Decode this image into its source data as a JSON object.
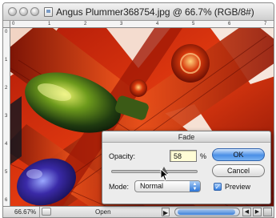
{
  "window": {
    "title": "Angus Plummer368754.jpg @ 66.7% (RGB/8#)",
    "zoom": "66.67%",
    "status_label": "Open",
    "status_arrow": "▶"
  },
  "rulers": {
    "top_numbers": [
      "0",
      "1",
      "2",
      "3",
      "4",
      "5",
      "6",
      "7"
    ],
    "left_numbers": [
      "0",
      "1",
      "2",
      "3",
      "4",
      "5",
      "6"
    ]
  },
  "dialog": {
    "title": "Fade",
    "opacity_label": "Opacity:",
    "opacity_value": "58",
    "opacity_unit": "%",
    "mode_label": "Mode:",
    "mode_value": "Normal",
    "ok_label": "OK",
    "cancel_label": "Cancel",
    "preview_label": "Preview",
    "preview_checked": true,
    "slider_value_percent": 58
  },
  "icons": [
    "close-icon",
    "minimize-icon",
    "zoom-icon",
    "document-proxy-icon",
    "chevron-updown-icon",
    "checkmark-icon",
    "pointer-cursor-icon"
  ]
}
